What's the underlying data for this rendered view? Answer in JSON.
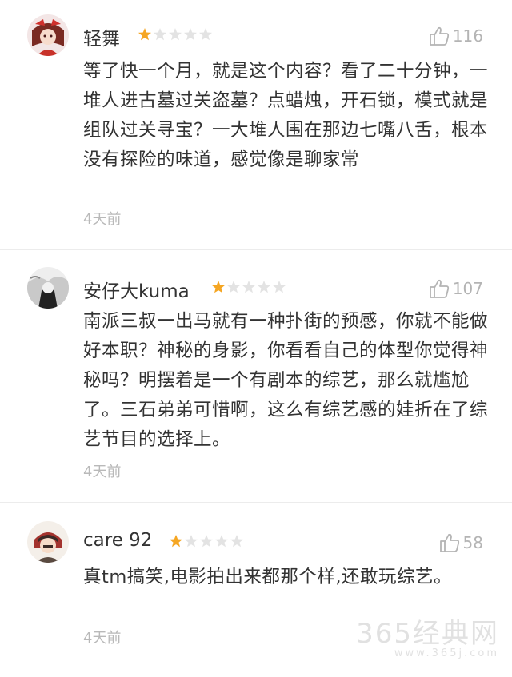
{
  "comments": [
    {
      "username": "轻舞",
      "rating": 1,
      "likes": "116",
      "text": "等了快一个月，就是这个内容？看了二十分钟，一堆人进古墓过关盗墓？点蜡烛，开石锁，模式就是组队过关寻宝？一大堆人围在那边七嘴八舌，根本没有探险的味道，感觉像是聊家常",
      "time": "4天前"
    },
    {
      "username": "安仔大kuma",
      "rating": 1,
      "likes": "107",
      "text": "南派三叔一出马就有一种扑街的预感，你就不能做好本职？神秘的身影，你看看自己的体型你觉得神秘吗？明摆着是一个有剧本的综艺，那么就尴尬了。三石弟弟可惜啊，这么有综艺感的娃折在了综艺节目的选择上。",
      "time": "4天前"
    },
    {
      "username": "care 92",
      "rating": 1,
      "likes": "58",
      "text": "真tm搞笑,电影拍出来都那个样,还敢玩综艺。",
      "time": "4天前"
    }
  ],
  "watermark": {
    "brand": "365经典网",
    "site": "www.365j.com"
  },
  "colors": {
    "star_on": "#f5a623",
    "star_off": "#e3e3e3",
    "muted": "#b4b4b4"
  }
}
